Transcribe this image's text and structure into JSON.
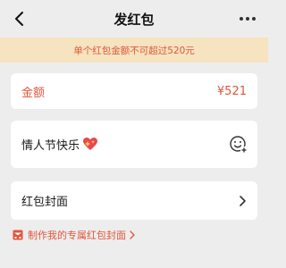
{
  "nav": {
    "title": "发红包",
    "back_icon": "chevron-left-icon",
    "more_icon": "more-icon"
  },
  "warning": {
    "text": "单个红包金额不可超过520元"
  },
  "amount": {
    "label": "金额",
    "value": "¥521"
  },
  "message": {
    "text": "情人节快乐",
    "emoji_icon": "smiley-add-icon"
  },
  "cover": {
    "label": "红包封面"
  },
  "custom_cover_link": {
    "text": "制作我的专属红包封面"
  },
  "colors": {
    "accent": "#e0563b",
    "warning_bg": "#f6e3bf",
    "page_bg": "#ededed"
  }
}
